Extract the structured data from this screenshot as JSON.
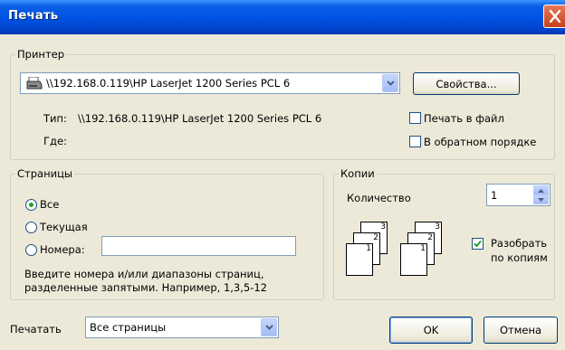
{
  "window": {
    "title": "Печать"
  },
  "printer": {
    "group_label": "Принтер",
    "selected": "\\\\192.168.0.119\\HP LaserJet 1200 Series PCL 6",
    "properties_label": "Свойства...",
    "type_label": "Тип:",
    "type_value": "\\\\192.168.0.119\\HP LaserJet 1200 Series PCL 6",
    "where_label": "Где:",
    "print_to_file_label": "Печать в файл",
    "print_to_file_checked": false,
    "reverse_order_label": "В обратном порядке",
    "reverse_order_checked": false
  },
  "pages": {
    "group_label": "Страницы",
    "all_label": "Все",
    "current_label": "Текущая",
    "numbers_label": "Номера:",
    "numbers_value": "",
    "selected": "all",
    "hint_line1": "Введите номера и/или диапазоны страниц,",
    "hint_line2": "разделенные запятыми. Например, 1,3,5-12"
  },
  "copies": {
    "group_label": "Копии",
    "count_label": "Количество",
    "count_value": "1",
    "collate_label_line1": "Разобрать",
    "collate_label_line2": "по копиям",
    "collate_checked": true,
    "page_numbers": [
      "1",
      "2",
      "3"
    ]
  },
  "footer": {
    "print_label": "Печатать",
    "print_value": "Все страницы",
    "ok_label": "OK",
    "cancel_label": "Отмена"
  }
}
